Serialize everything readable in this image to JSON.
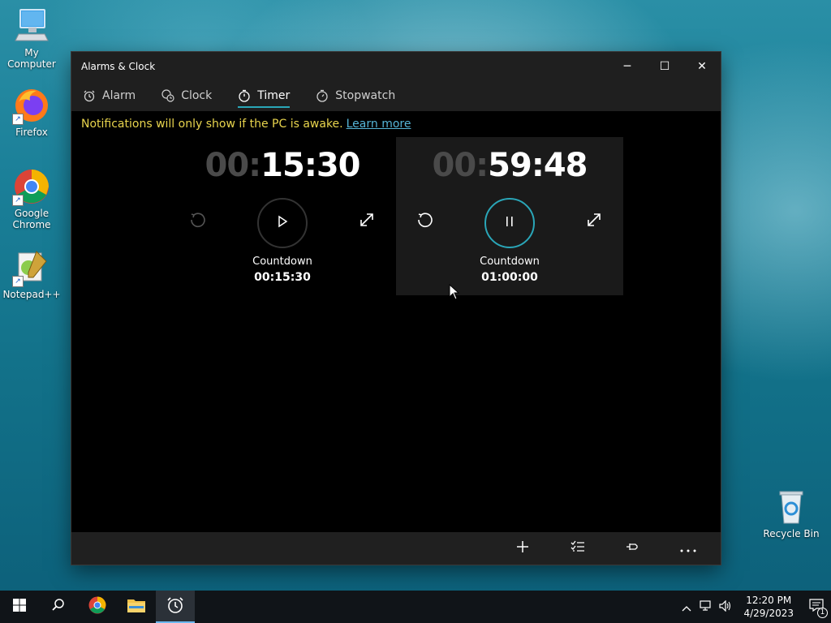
{
  "desktop": {
    "icons": [
      {
        "label": "My Computer"
      },
      {
        "label": "Firefox"
      },
      {
        "label": "Google Chrome"
      },
      {
        "label": "Notepad++"
      },
      {
        "label": "Recycle Bin"
      }
    ]
  },
  "window": {
    "title": "Alarms & Clock",
    "controls": {
      "minimize": "─",
      "maximize": "☐",
      "close": "✕"
    },
    "tabs": [
      {
        "label": "Alarm",
        "icon": "alarm-icon"
      },
      {
        "label": "Clock",
        "icon": "globe-clock-icon"
      },
      {
        "label": "Timer",
        "icon": "timer-icon",
        "active": true
      },
      {
        "label": "Stopwatch",
        "icon": "stopwatch-icon"
      }
    ],
    "notice": {
      "text": "Notifications will only show if the PC is awake.",
      "link": "Learn more"
    },
    "timers": [
      {
        "hours": "00:",
        "rest": "15:30",
        "label": "Countdown",
        "total": "00:15:30",
        "state": "stopped"
      },
      {
        "hours": "00:",
        "rest": "59:48",
        "label": "Countdown",
        "total": "01:00:00",
        "state": "running"
      }
    ],
    "commands": [
      "add-icon",
      "select-list-icon",
      "pin-icon",
      "more-icon"
    ]
  },
  "taskbar": {
    "apps": [
      "start-icon",
      "search-icon",
      "chrome-icon",
      "file-explorer-icon",
      "alarms-clock-icon"
    ],
    "time": "12:20 PM",
    "date": "4/29/2023",
    "notifications_count": "1"
  },
  "colors": {
    "accent": "#2aa6b8",
    "notice": "#e8d44d",
    "link": "#55b4d6"
  }
}
